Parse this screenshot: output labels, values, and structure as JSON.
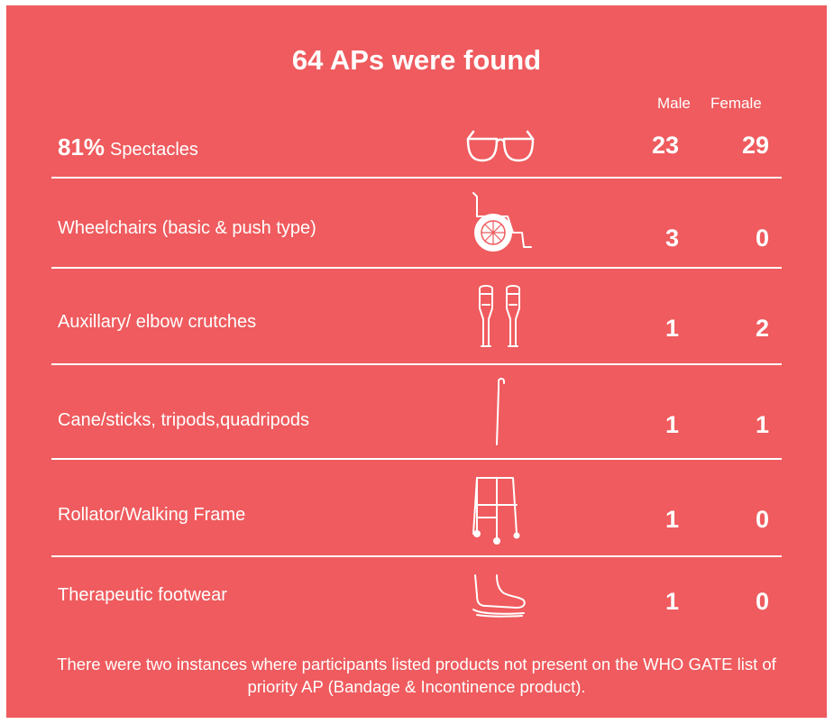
{
  "colors": {
    "panel": "#ef5b5e",
    "text": "#ffffff",
    "page": "#ffffff"
  },
  "title": "64 APs were found",
  "columns": {
    "male": "Male",
    "female": "Female"
  },
  "rows": [
    {
      "percent": "81%",
      "label": "Spectacles",
      "icon": "spectacles-icon",
      "male": "23",
      "female": "29"
    },
    {
      "label": "Wheelchairs (basic & push type)",
      "icon": "wheelchair-icon",
      "male": "3",
      "female": "0"
    },
    {
      "label": "Auxillary/ elbow crutches",
      "icon": "crutches-icon",
      "male": "1",
      "female": "2"
    },
    {
      "label": "Cane/sticks, tripods,quadripods",
      "icon": "cane-icon",
      "male": "1",
      "female": "1"
    },
    {
      "label": "Rollator/Walking Frame",
      "icon": "walking-frame-icon",
      "male": "1",
      "female": "0"
    },
    {
      "label": "Therapeutic footwear",
      "icon": "footwear-icon",
      "male": "1",
      "female": "0"
    }
  ],
  "footnote": "There were two instances where participants listed products not present on the WHO GATE list of priority AP (Bandage & Incontinence product)."
}
